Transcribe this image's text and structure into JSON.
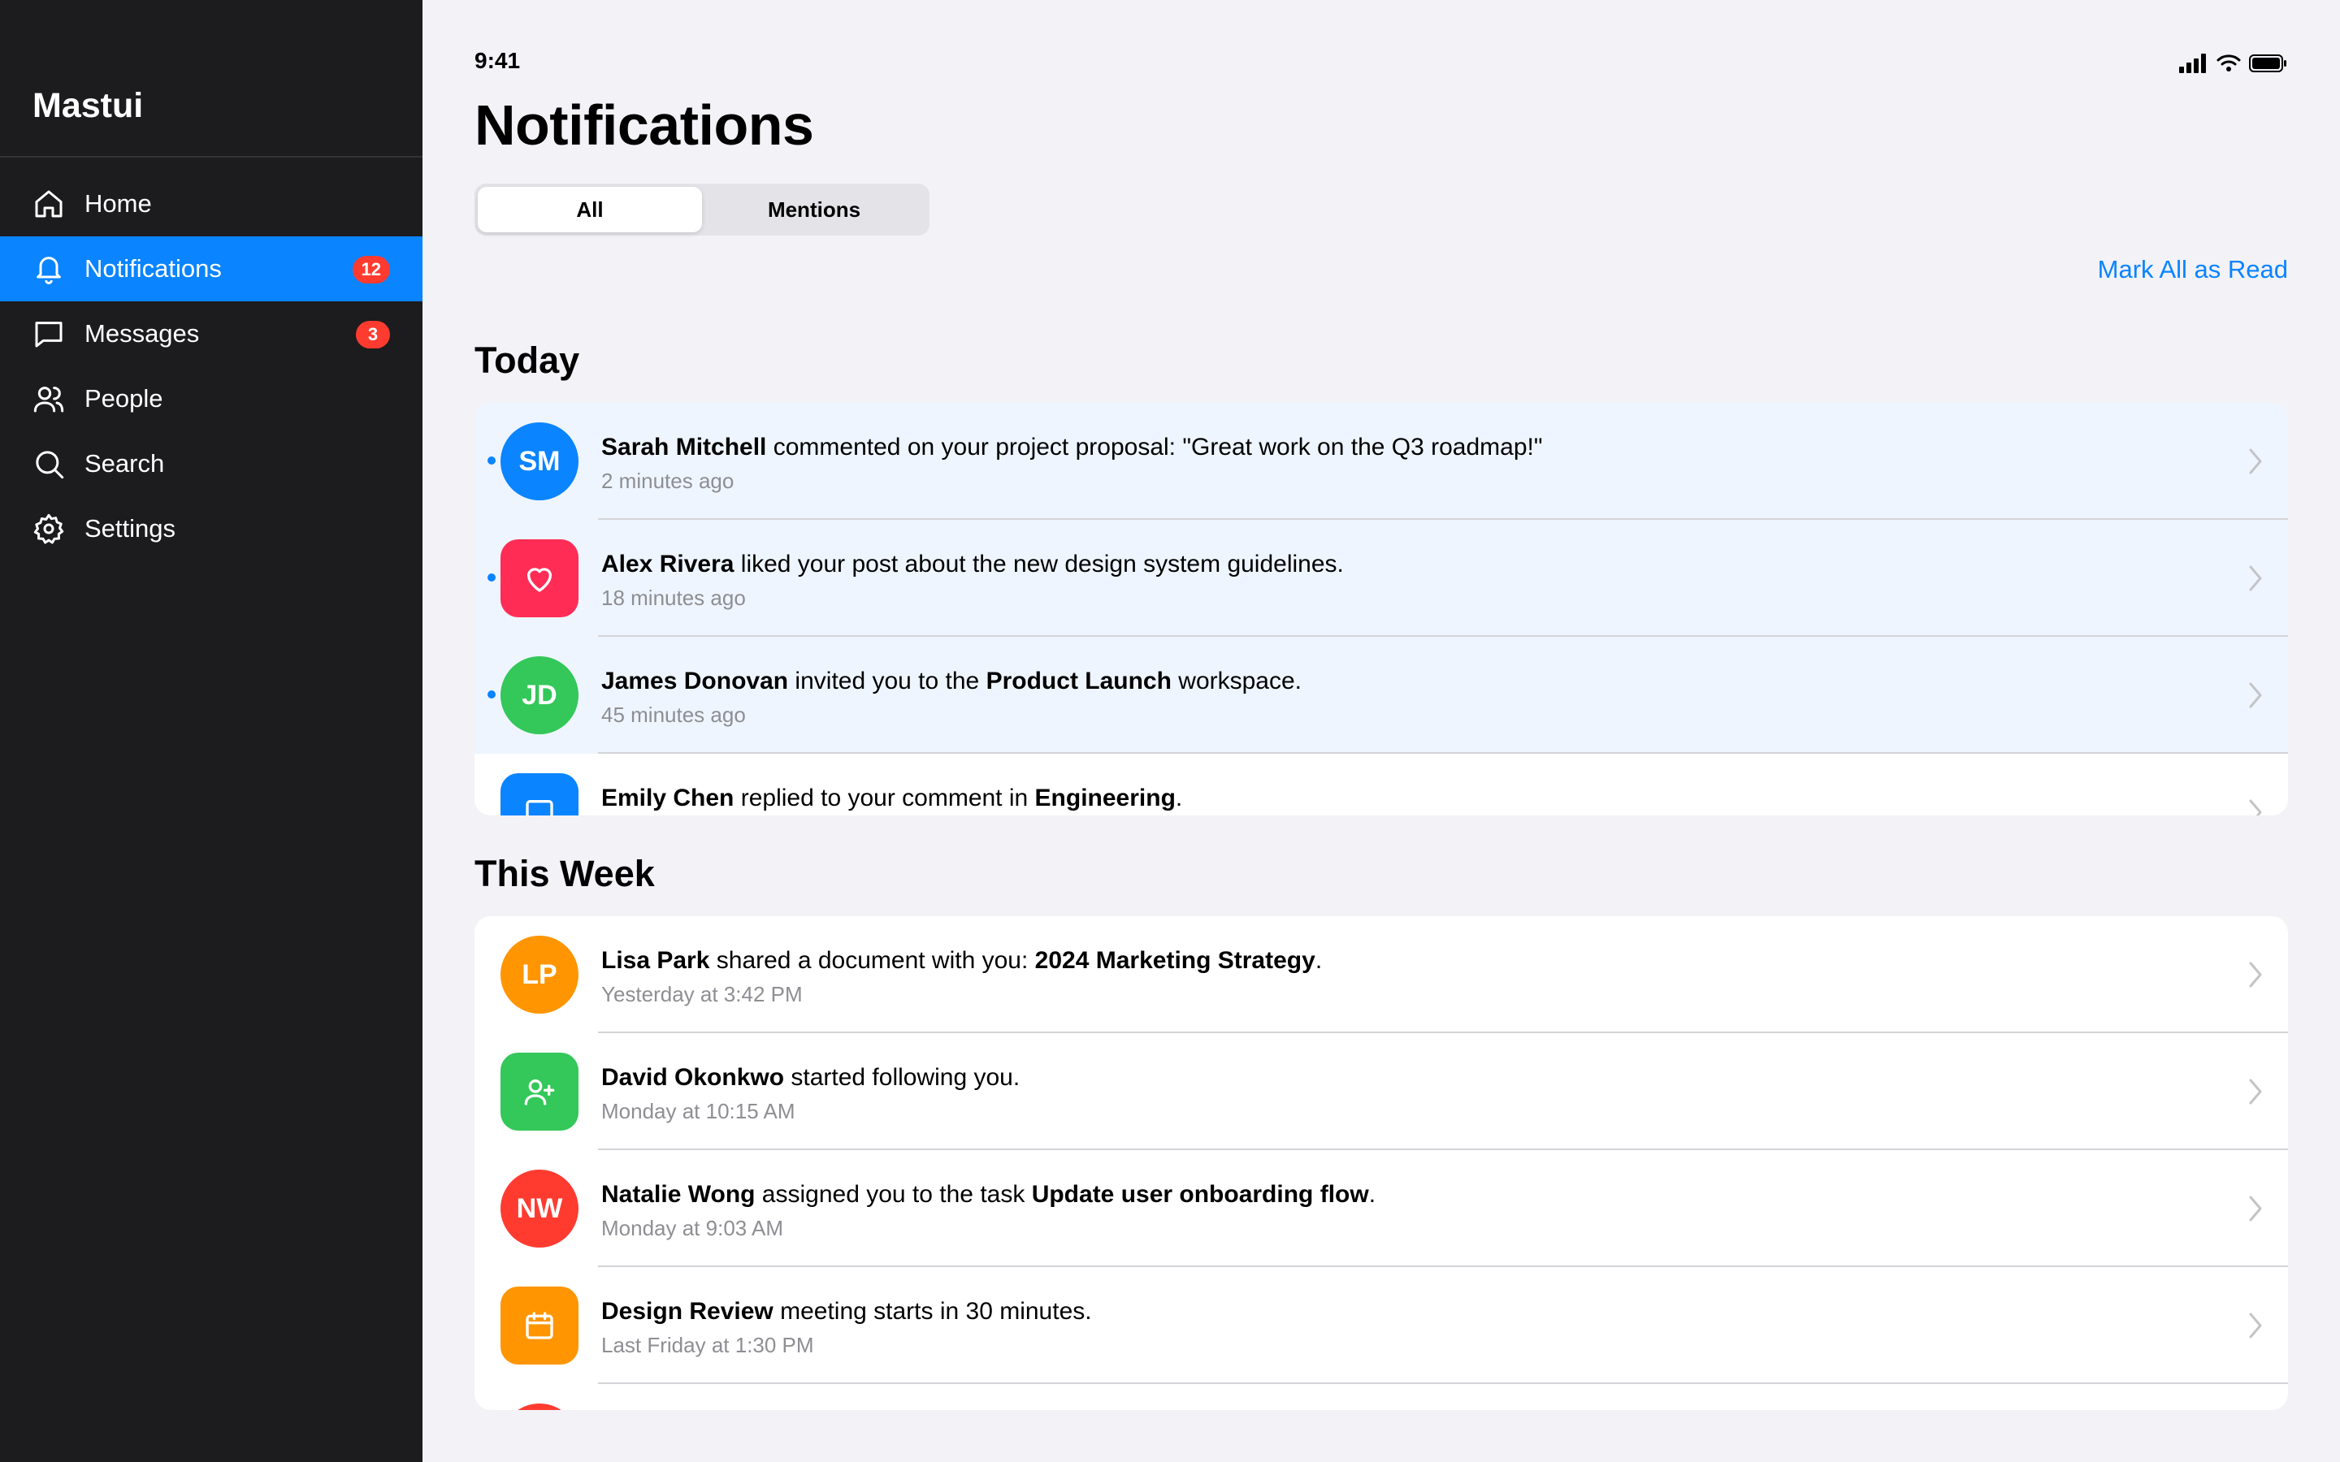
{
  "status_bar": {
    "time": "9:41"
  },
  "sidebar": {
    "brand": "Mastui",
    "items": [
      {
        "label": "Home",
        "icon": "home-icon"
      },
      {
        "label": "Notifications",
        "icon": "bell-icon",
        "badge": "12",
        "active": true
      },
      {
        "label": "Messages",
        "icon": "message-icon",
        "badge": "3"
      },
      {
        "label": "People",
        "icon": "people-icon"
      },
      {
        "label": "Search",
        "icon": "search-icon"
      },
      {
        "label": "Settings",
        "icon": "gear-icon"
      }
    ]
  },
  "header": {
    "title": "Notifications",
    "tabs": [
      {
        "label": "All",
        "active": true
      },
      {
        "label": "Mentions",
        "active": false
      }
    ],
    "mark_all_read": "Mark All as Read"
  },
  "sections": [
    {
      "title": "Today",
      "items": [
        {
          "initials": "SM",
          "color": "#0a84ff",
          "unread": true,
          "actor": "Sarah Mitchell",
          "text": " commented on your project proposal: \"Great work on the Q3 roadmap!\"",
          "time": "2 minutes ago"
        },
        {
          "icon": "heart-icon",
          "color": "#ff2d55",
          "unread": true,
          "actor": "Alex Rivera",
          "text": " liked your post about the new design system guidelines.",
          "time": "18 minutes ago"
        },
        {
          "initials": "JD",
          "color": "#34c759",
          "unread": true,
          "actor": "James Donovan",
          "text": " invited you to the ",
          "bold2": "Product Launch",
          "text2": " workspace.",
          "time": "45 minutes ago"
        },
        {
          "icon": "reply-icon",
          "color": "#0a84ff",
          "unread": false,
          "actor": "Emily Chen",
          "text": " replied to your comment in ",
          "bold2": "Engineering",
          "text2": ".",
          "time": ""
        }
      ]
    },
    {
      "title": "This Week",
      "items": [
        {
          "initials": "LP",
          "color": "#ff9500",
          "unread": false,
          "actor": "Lisa Park",
          "text": " shared a document with you: ",
          "bold2": "2024 Marketing Strategy",
          "text2": ".",
          "time": "Yesterday at 3:42 PM"
        },
        {
          "icon": "person-add-icon",
          "color": "#34c759",
          "unread": false,
          "actor": "David Okonkwo",
          "text": " started following you.",
          "time": "Monday at 10:15 AM"
        },
        {
          "initials": "NW",
          "color": "#ff3b30",
          "unread": false,
          "actor": "Natalie Wong",
          "text": " assigned you to the task ",
          "bold2": "Update user onboarding flow",
          "text2": ".",
          "time": "Monday at 9:03 AM"
        },
        {
          "icon": "calendar-icon",
          "color": "#ff9500",
          "unread": false,
          "actor": "Design Review",
          "text": " meeting starts in 30 minutes.",
          "time": "Last Friday at 1:30 PM"
        },
        {
          "initials": "",
          "color": "#ff3b30",
          "unread": false,
          "actor": "",
          "text": "",
          "time": ""
        }
      ]
    }
  ]
}
